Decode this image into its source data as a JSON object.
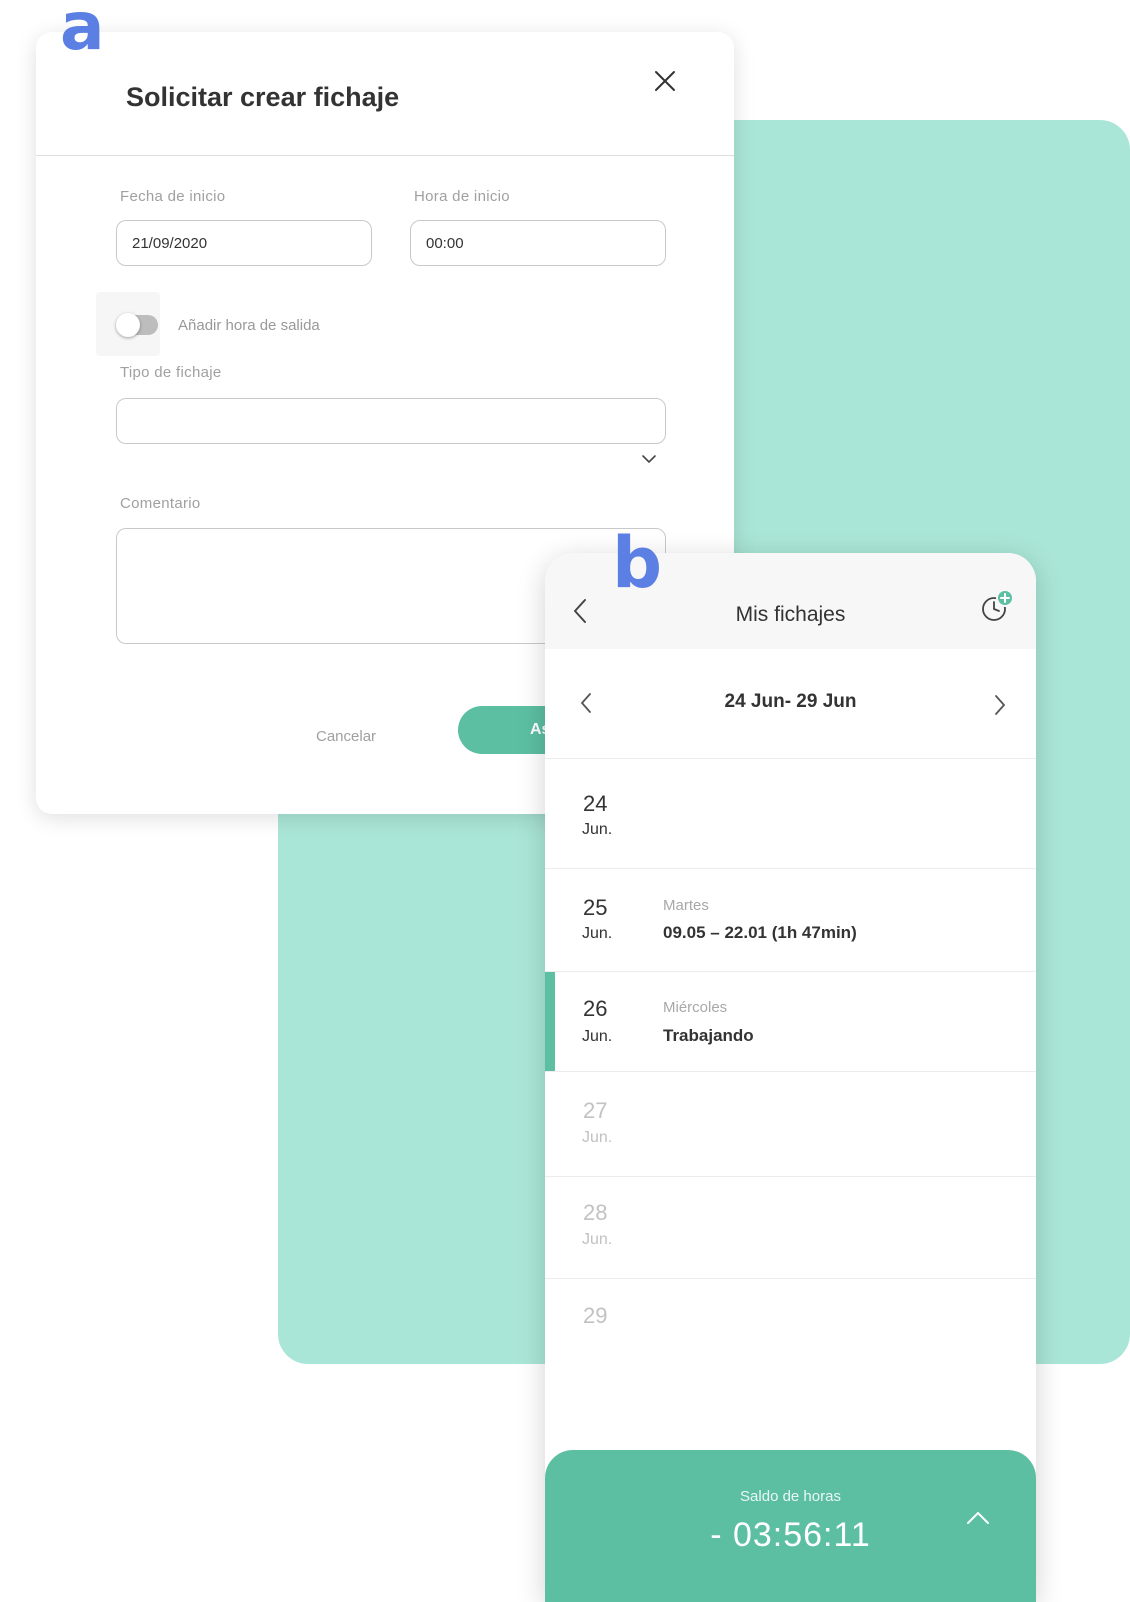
{
  "labels": {
    "a": "a",
    "b": "b"
  },
  "dialog": {
    "title": "Solicitar crear fichaje",
    "start_date_label": "Fecha de inicio",
    "start_date_value": "21/09/2020",
    "start_time_label": "Hora de inicio",
    "start_time_value": "00:00",
    "toggle_label": "Añadir hora de salida",
    "type_label": "Tipo de fichaje",
    "type_value": "",
    "comment_label": "Comentario",
    "comment_value": "",
    "cancel_label": "Cancelar",
    "accept_label": "As"
  },
  "phone": {
    "title": "Mis fichajes",
    "week_range": "24 Jun- 29 Jun",
    "days": [
      {
        "num": "24",
        "month": "Jun.",
        "weekday": "",
        "info": ""
      },
      {
        "num": "25",
        "month": "Jun.",
        "weekday": "Martes",
        "info": "09.05 – 22.01 (1h 47min)"
      },
      {
        "num": "26",
        "month": "Jun.",
        "weekday": "Miércoles",
        "info": "Trabajando"
      },
      {
        "num": "27",
        "month": "Jun.",
        "weekday": "",
        "info": ""
      },
      {
        "num": "28",
        "month": "Jun.",
        "weekday": "",
        "info": ""
      },
      {
        "num": "29",
        "month": "",
        "weekday": "",
        "info": ""
      }
    ],
    "balance_label": "Saldo de horas",
    "balance_value": "- 03:56:11"
  },
  "colors": {
    "accent": "#5cbfa2",
    "background_panel": "#aae6d7",
    "label": "#5b7fe3"
  },
  "icons": [
    "close-icon",
    "chevron-down-icon",
    "back-icon",
    "clock-add-icon",
    "chevron-left-icon",
    "chevron-right-icon",
    "chevron-up-icon"
  ]
}
